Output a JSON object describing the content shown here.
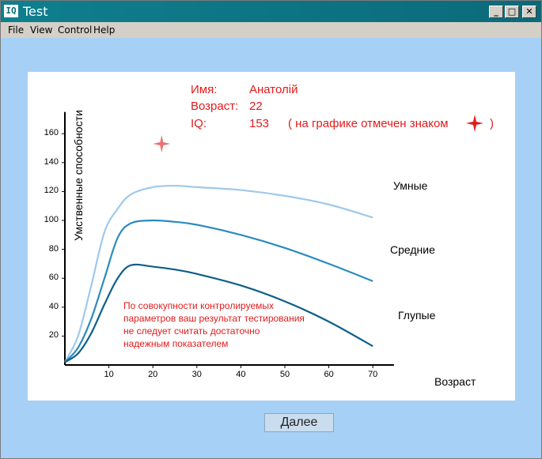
{
  "window": {
    "title": "Test",
    "icon_label": "IQ"
  },
  "window_controls": {
    "minimize": "_",
    "maximize": "□",
    "close": "✕"
  },
  "menu": {
    "items": [
      {
        "label": "File"
      },
      {
        "label": "View"
      },
      {
        "label": "Control"
      },
      {
        "label": "Help"
      }
    ]
  },
  "info": {
    "name_label": "Имя:",
    "name_value": "Анатолій",
    "age_label": "Возраст:",
    "age_value": "22",
    "iq_label": "IQ:",
    "iq_value": "153",
    "iq_note_open": "( на графике отмечен знаком",
    "iq_note_close": ")"
  },
  "note": "По совокупности контролируемых параметров ваш результат тестирования не следует считать достаточно надежным показателем",
  "next_button": "Далее",
  "colors": {
    "accent_red": "#e31b1b",
    "smart": "#9fc9ea",
    "average": "#2b8bbf",
    "dumb": "#0e5f88"
  },
  "chart_data": {
    "type": "line",
    "xlabel": "Возраст",
    "ylabel": "Умственные способности",
    "x_ticks": [
      10,
      20,
      30,
      40,
      50,
      60,
      70
    ],
    "y_ticks": [
      20,
      40,
      60,
      80,
      100,
      120,
      140,
      160
    ],
    "xlim": [
      0,
      73
    ],
    "ylim": [
      0,
      175
    ],
    "series": [
      {
        "name": "Умные",
        "x": [
          0,
          3,
          6,
          9,
          12,
          15,
          20,
          25,
          30,
          40,
          50,
          60,
          70
        ],
        "y": [
          2,
          20,
          55,
          92,
          108,
          118,
          123,
          124,
          123,
          121,
          117,
          111,
          102
        ]
      },
      {
        "name": "Средние",
        "x": [
          0,
          3,
          6,
          9,
          12,
          15,
          20,
          25,
          30,
          40,
          50,
          60,
          70
        ],
        "y": [
          2,
          12,
          32,
          60,
          88,
          98,
          100,
          99,
          97,
          90,
          81,
          70,
          58
        ]
      },
      {
        "name": "Глупые",
        "x": [
          0,
          3,
          6,
          9,
          12,
          15,
          20,
          25,
          30,
          40,
          50,
          60,
          70
        ],
        "y": [
          2,
          8,
          22,
          42,
          60,
          69,
          68,
          66,
          63,
          55,
          44,
          30,
          13
        ]
      }
    ],
    "marker": {
      "x": 22,
      "y": 153
    }
  }
}
